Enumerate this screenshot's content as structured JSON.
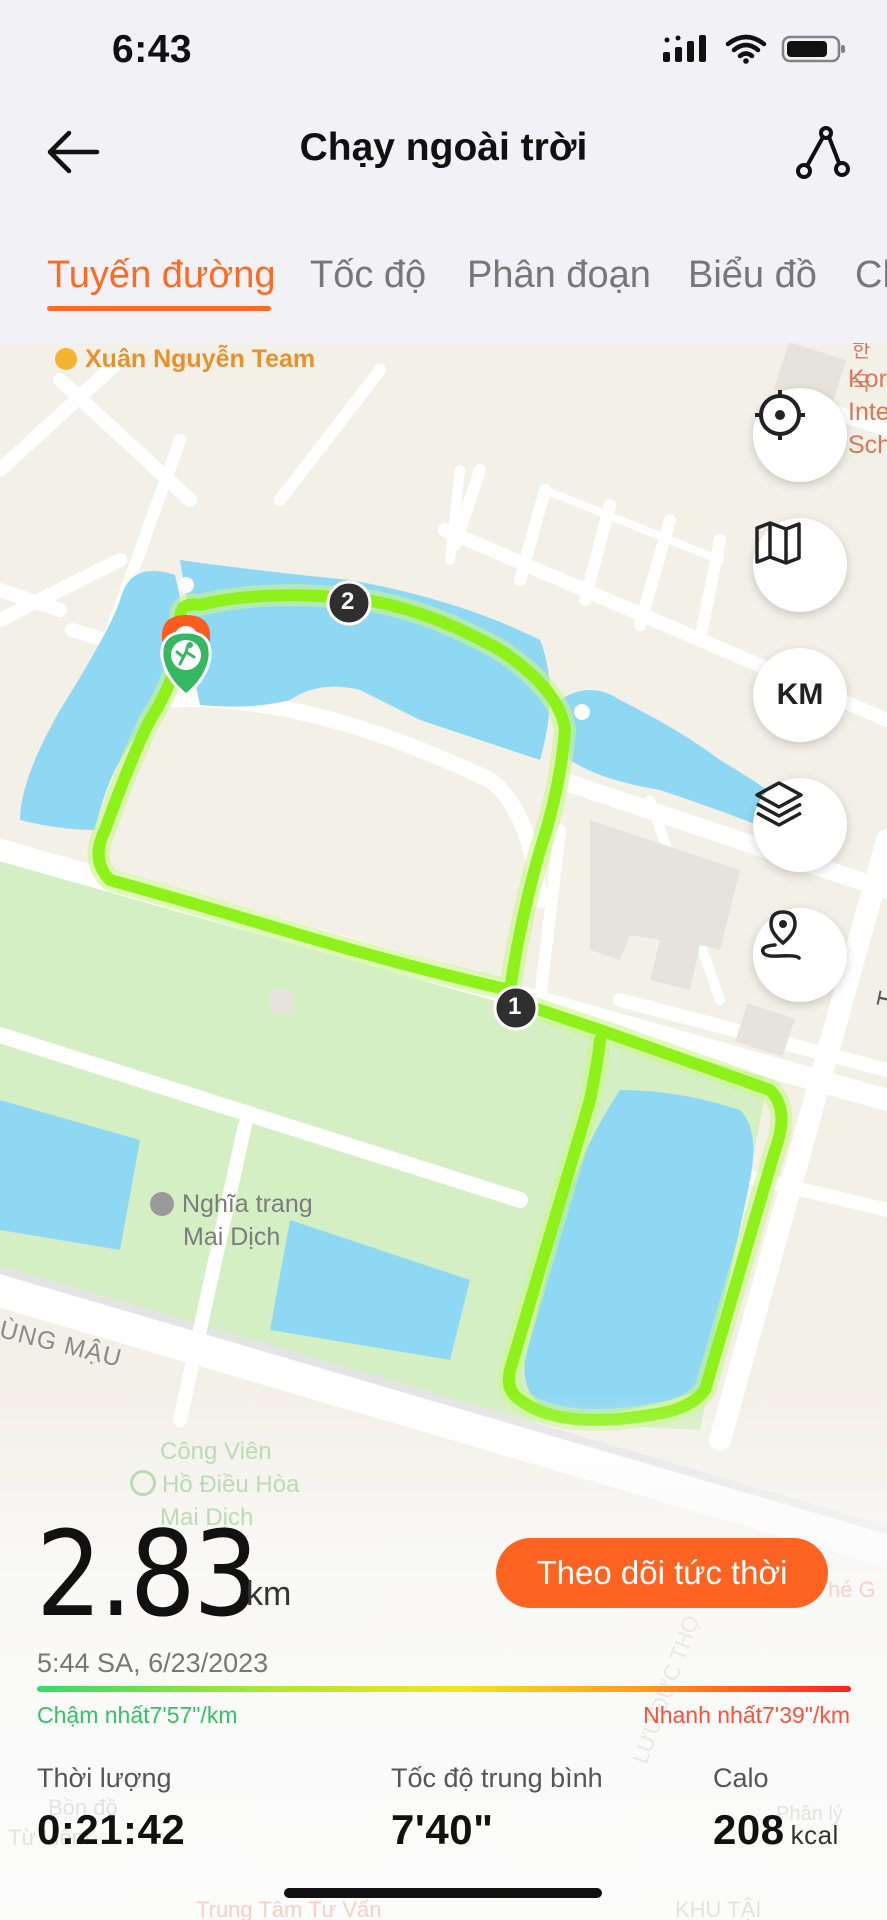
{
  "status_bar": {
    "time": "6:43"
  },
  "header": {
    "title": "Chạy ngoài trời"
  },
  "tabs": [
    {
      "label": "Tuyến đường",
      "active": true
    },
    {
      "label": "Tốc độ",
      "active": false
    },
    {
      "label": "Phân đoạn",
      "active": false
    },
    {
      "label": "Biểu đồ",
      "active": false
    },
    {
      "label": "Ch",
      "active": false
    }
  ],
  "map": {
    "labels": {
      "team": "Xuân Nguyễn Team",
      "school_line1": "Kor",
      "school_line2": "Inte",
      "school_line3": "Sch",
      "korean": "한국",
      "cemetery_line1": "Nghĩa trang",
      "cemetery_line2": "Mai Dịch",
      "street": "ÙNG MẬU",
      "park_line1": "Công Viên",
      "park_line2": "Hồ Điều Hòa",
      "park_line3": "Mai Dịch",
      "street_right": "T",
      "bottom_left_1": "Bồn đồ",
      "bottom_left_2": "Từ Liêm",
      "bottom_center": "Trung Tâm Tư Vấn",
      "bottom_right": "KHU TẬI",
      "right_small": "Phân lý",
      "right_g": "hé G",
      "vertical_street": "LƯU ĐỨC THỌ"
    },
    "markers": [
      "1",
      "2"
    ],
    "buttons": {
      "unit": "KM"
    }
  },
  "summary": {
    "distance": "2.83",
    "distance_unit": "km",
    "live_button": "Theo dõi tức thời",
    "datetime": "5:44 SA, 6/23/2023",
    "slowest": "Chậm nhất7'57\"/km",
    "fastest": "Nhanh nhất7'39\"/km",
    "duration_label": "Thời lượng",
    "duration_value": "0:21:42",
    "avg_pace_label": "Tốc độ trung bình",
    "avg_pace_value": "7'40\"",
    "calories_label": "Calo",
    "calories_value": "208",
    "calories_unit": "kcal"
  },
  "colors": {
    "accent": "#ff6a22",
    "route": "#8ef21a",
    "water": "#8fd8f4",
    "park": "#d4efc3",
    "start_marker": "#36b862",
    "end_marker": "#ff5a1f"
  }
}
